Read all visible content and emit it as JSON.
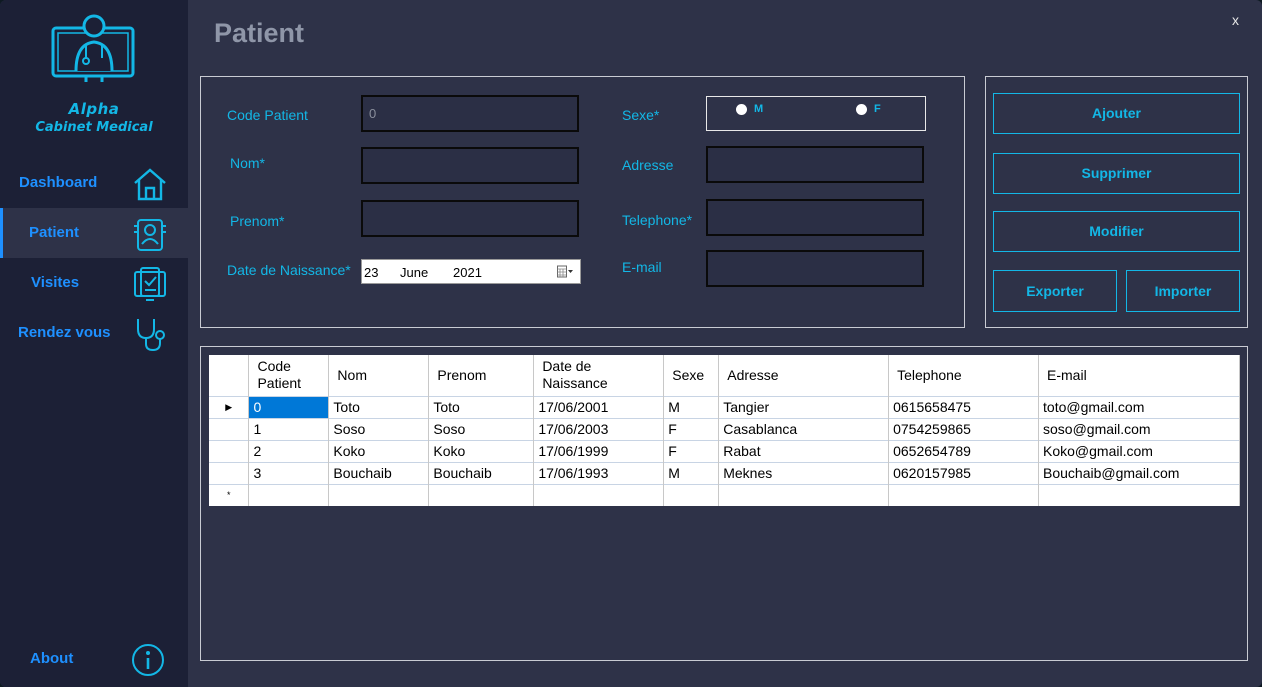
{
  "window": {
    "title": "Patient",
    "close_label": "x"
  },
  "brand": {
    "line1": "Alpha",
    "line2": "Cabinet Medical",
    "logo_icon": "doctor-monitor-icon"
  },
  "sidebar": {
    "items": [
      {
        "label": "Dashboard",
        "icon": "home-icon",
        "active": false
      },
      {
        "label": "Patient",
        "icon": "patient-card-icon",
        "active": true
      },
      {
        "label": "Visites",
        "icon": "clipboard-icon",
        "active": false
      },
      {
        "label": "Rendez vous",
        "icon": "stethoscope-icon",
        "active": false
      }
    ],
    "about": {
      "label": "About",
      "icon": "info-icon"
    }
  },
  "form": {
    "code_label": "Code Patient",
    "code_value": "0",
    "nom_label": "Nom*",
    "nom_value": "",
    "prenom_label": "Prenom*",
    "prenom_value": "",
    "dob_label": "Date de Naissance*",
    "dob_day": "23",
    "dob_month": "June",
    "dob_year": "2021",
    "sexe_label": "Sexe*",
    "sexe_options": [
      "M",
      "F"
    ],
    "adresse_label": "Adresse",
    "adresse_value": "",
    "telephone_label": "Telephone*",
    "telephone_value": "",
    "email_label": "E-mail",
    "email_value": ""
  },
  "actions": {
    "ajouter": "Ajouter",
    "supprimer": "Supprimer",
    "modifier": "Modifier",
    "exporter": "Exporter",
    "importer": "Importer"
  },
  "table": {
    "columns": [
      "Code Patient",
      "Nom",
      "Prenom",
      "Date de Naissance",
      "Sexe",
      "Adresse",
      "Telephone",
      "E-mail"
    ],
    "rows": [
      [
        "0",
        "Toto",
        "Toto",
        "17/06/2001",
        "M",
        "Tangier",
        "0615658475",
        "toto@gmail.com"
      ],
      [
        "1",
        "Soso",
        "Soso",
        "17/06/2003",
        "F",
        "Casablanca",
        "0754259865",
        "soso@gmail.com"
      ],
      [
        "2",
        "Koko",
        "Koko",
        "17/06/1999",
        "F",
        "Rabat",
        "0652654789",
        "Koko@gmail.com"
      ],
      [
        "3",
        "Bouchaib",
        "Bouchaib",
        "17/06/1993",
        "M",
        "Meknes",
        "0620157985",
        "Bouchaib@gmail.com"
      ]
    ],
    "selected_row": 0,
    "current_row_marker": "▶",
    "new_row_marker": "*"
  },
  "colors": {
    "accent": "#13b7e6",
    "nav": "#1e90ff",
    "sidebar": "#1c2036",
    "main": "#2e3248"
  }
}
